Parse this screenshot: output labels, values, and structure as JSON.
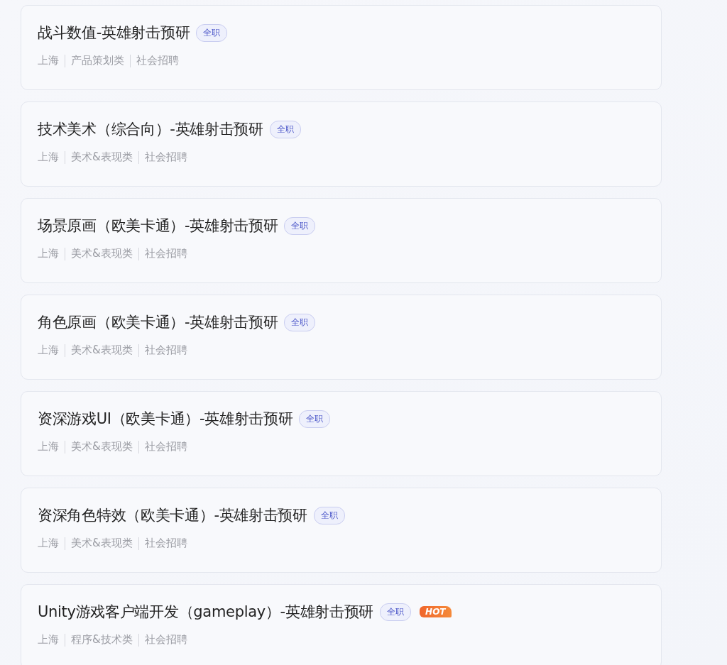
{
  "jobs": [
    {
      "title": "战斗数值-英雄射击预研",
      "type_tag": "全职",
      "meta": [
        "上海",
        "产品策划类",
        "社会招聘"
      ]
    },
    {
      "title": "技术美术（综合向）-英雄射击预研",
      "type_tag": "全职",
      "meta": [
        "上海",
        "美术&表现类",
        "社会招聘"
      ]
    },
    {
      "title": "场景原画（欧美卡通）-英雄射击预研",
      "type_tag": "全职",
      "meta": [
        "上海",
        "美术&表现类",
        "社会招聘"
      ]
    },
    {
      "title": "角色原画（欧美卡通）-英雄射击预研",
      "type_tag": "全职",
      "meta": [
        "上海",
        "美术&表现类",
        "社会招聘"
      ]
    },
    {
      "title": "资深游戏UI（欧美卡通）-英雄射击预研",
      "type_tag": "全职",
      "meta": [
        "上海",
        "美术&表现类",
        "社会招聘"
      ]
    },
    {
      "title": "资深角色特效（欧美卡通）-英雄射击预研",
      "type_tag": "全职",
      "meta": [
        "上海",
        "美术&表现类",
        "社会招聘"
      ]
    },
    {
      "title": "Unity游戏客户端开发（gameplay）-英雄射击预研",
      "type_tag": "全职",
      "hot_badge": "HOT",
      "meta": [
        "上海",
        "程序&技术类",
        "社会招聘"
      ]
    }
  ]
}
